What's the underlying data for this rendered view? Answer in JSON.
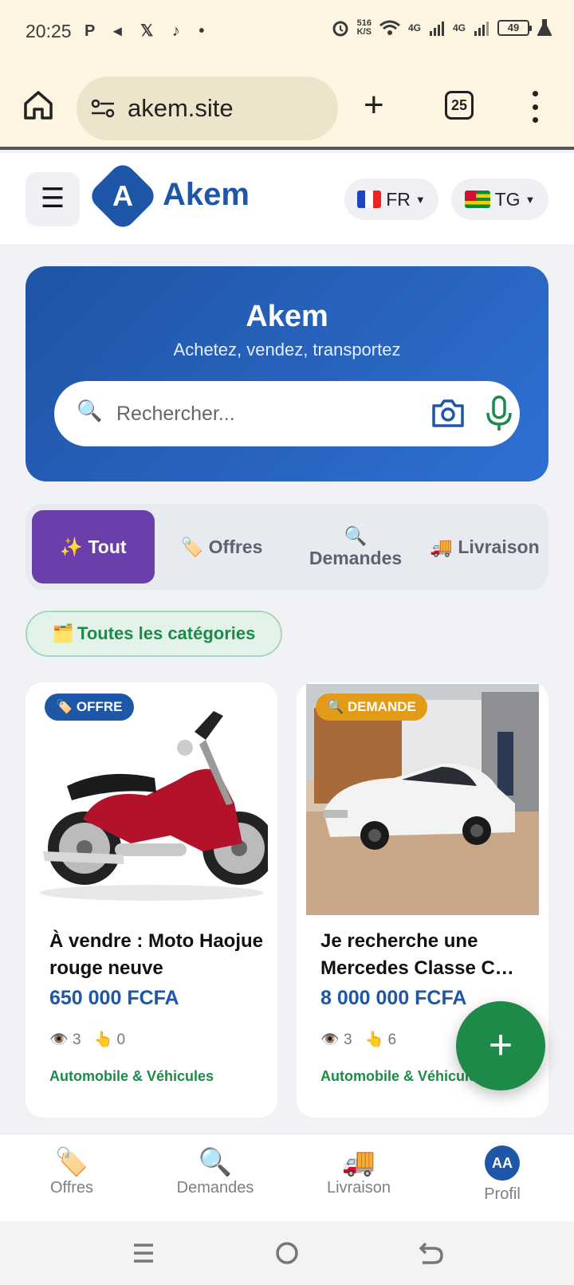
{
  "status_bar": {
    "time": "20:25",
    "left_icons": "P ◂ 𝕏 ♪ •",
    "speed_top": "516",
    "speed_bottom": "K/S",
    "network_1": "4G",
    "network_2": "4G",
    "battery": "49"
  },
  "browser": {
    "url": "akem.site",
    "tabs_count": "25"
  },
  "header": {
    "logo_letter": "A",
    "brand": "Akem",
    "lang": "FR",
    "country": "TG"
  },
  "hero": {
    "title": "Akem",
    "subtitle": "Achetez, vendez, transportez",
    "search_placeholder": "Rechercher..."
  },
  "filters": [
    {
      "icon": "✨",
      "label": "Tout",
      "active": true
    },
    {
      "icon": "🏷️",
      "label": "Offres",
      "active": false
    },
    {
      "icon": "🔍",
      "label": "Demandes",
      "active": false
    },
    {
      "icon": "🚚",
      "label": "Livraison",
      "active": false
    }
  ],
  "category_chip": {
    "icon": "🗂️",
    "label": "Toutes les catégories"
  },
  "listings": [
    {
      "badge": "🏷️ OFFRE",
      "title": "À vendre : Moto Haojue rouge neuve",
      "price": "650 000 FCFA",
      "views": "3",
      "clicks": "0",
      "category": "Automobile & Véhicules"
    },
    {
      "badge": "🔍 DEMANDE",
      "title": "Je recherche une Mercedes Classe C…",
      "price": "8 000 000 FCFA",
      "views": "3",
      "clicks": "6",
      "category": "Automobile & Véhicules"
    }
  ],
  "fab": {
    "label": "+"
  },
  "bottom_nav": [
    {
      "icon": "🏷️",
      "label": "Offres"
    },
    {
      "icon": "🔍",
      "label": "Demandes"
    },
    {
      "icon": "🚚",
      "label": "Livraison"
    },
    {
      "avatar": "AA",
      "label": "Profil"
    }
  ],
  "icons": {
    "view": "👁️",
    "click": "👆"
  },
  "colors": {
    "brand_blue": "#1e56a8",
    "active_filter": "#6a3fa9",
    "green": "#1e8a4a",
    "demande_badge": "#e39a17",
    "offre_badge": "#1e56a8"
  }
}
